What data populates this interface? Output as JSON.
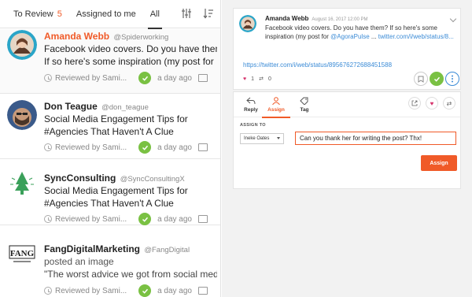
{
  "tabs": [
    {
      "label": "To Review",
      "count": "5"
    },
    {
      "label": "Assigned to me"
    },
    {
      "label": "All"
    }
  ],
  "inbox": [
    {
      "name": "Amanda Webb",
      "handle": "@Spiderworking",
      "text_lines": [
        "Facebook video covers. Do you have them?",
        "If so here's some inspiration (my post for"
      ],
      "reviewed": "Reviewed by Sami...",
      "time": "a day ago"
    },
    {
      "name": "Don Teague",
      "handle": "@don_teague",
      "text_lines": [
        "Social Media Engagement Tips for",
        "#Agencies That Haven't A Clue"
      ],
      "reviewed": "Reviewed by Sami...",
      "time": "a day ago"
    },
    {
      "name": "SyncConsulting",
      "handle": "@SyncConsultingX",
      "text_lines": [
        "Social Media Engagement Tips for",
        "#Agencies That Haven't A Clue"
      ],
      "reviewed": "Reviewed by Sami...",
      "time": "a day ago"
    },
    {
      "name": "FangDigitalMarketing",
      "handle": "@FangDigital",
      "text_lines": [
        "posted an image",
        "\"The worst advice we got from social media"
      ],
      "reviewed": "Reviewed by Sami...",
      "time": "a day ago"
    }
  ],
  "detail": {
    "author": "Amanda Webb",
    "date": "August 16, 2017 12:00 PM",
    "body_prefix": "Facebook video covers. Do you have them? If so here's some inspiration (my post for",
    "body_mention": "@AgoraPulse",
    "body_ellipsis": " ...",
    "body_link": "twitter.com/i/web/status/8...",
    "url": "https://twitter.com/i/web/status/895676272688451588",
    "likes": "1",
    "retweets": "0"
  },
  "actions": {
    "tabs": [
      {
        "label": "Reply",
        "icon": "reply-icon"
      },
      {
        "label": "Assign",
        "icon": "user-icon"
      },
      {
        "label": "Tag",
        "icon": "tag-icon"
      }
    ],
    "assign_to_label": "ASSIGN TO",
    "assignee": "Ineke Oates",
    "message": "Can you thank her for writing the post? Thx!",
    "assign_button": "Assign"
  },
  "colors": {
    "accent": "#f05a28",
    "success": "#7ac143",
    "link": "#3b8bd6"
  }
}
